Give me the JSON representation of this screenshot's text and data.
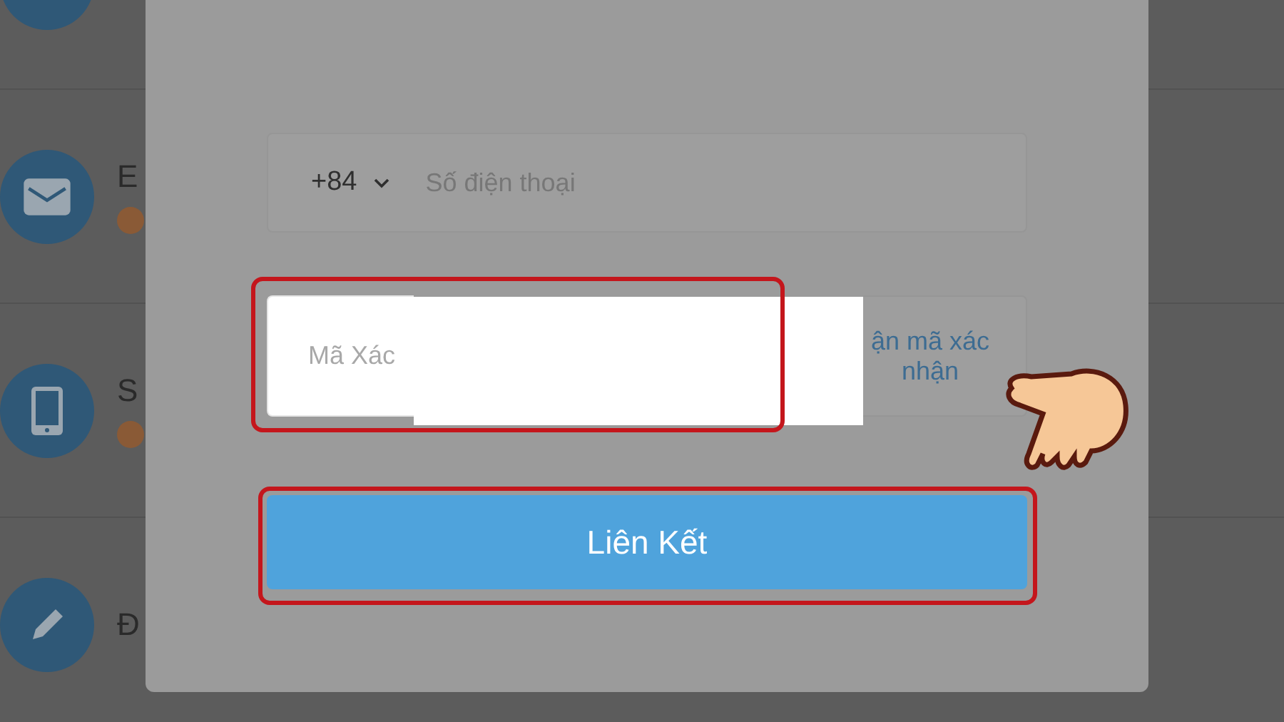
{
  "background_list": {
    "items": [
      {
        "kind": "generic",
        "warning": false
      },
      {
        "kind": "mail",
        "label": "E",
        "warning": true
      },
      {
        "kind": "phone",
        "label": "S",
        "warning": true
      },
      {
        "kind": "pencil",
        "label": "Đ",
        "warning": false
      }
    ]
  },
  "dialog": {
    "phone_field": {
      "country_code": "+84",
      "placeholder": "Số điện thoại"
    },
    "code_field": {
      "placeholder": "Mã Xác"
    },
    "send_code_button": {
      "label": "ận mã xác nhận"
    },
    "link_button": {
      "label": "Liên Kết"
    }
  },
  "annotations": {
    "highlight_code_field": true,
    "highlight_link_button": true,
    "pointing_hand": true,
    "redaction": true
  }
}
